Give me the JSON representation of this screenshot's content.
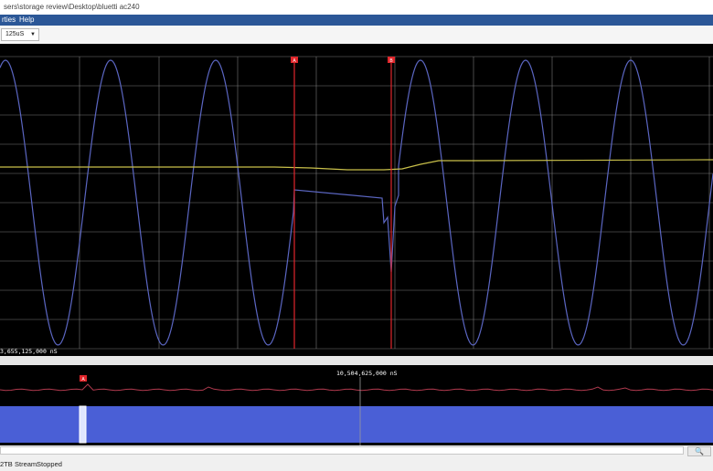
{
  "window": {
    "title": "sers\\storage review\\Desktop\\bluetti ac240"
  },
  "menu": {
    "items": [
      "rties",
      "Help"
    ]
  },
  "toolbar": {
    "timebase": "125uS"
  },
  "scope": {
    "cursor_a_label": "A",
    "cursor_b_label": "B",
    "time_readout": "3,655,125,000 nS",
    "trace_colors": {
      "voltage": "#5b66c2",
      "current": "#c9c04a",
      "grid": "#7a7a7a",
      "cursor": "#e0262b"
    }
  },
  "overview": {
    "cursor_label": "A",
    "time_readout": "10,504,625,000 nS",
    "colors": {
      "envelope": "#4a5fd6",
      "trend": "#b03a4e"
    }
  },
  "status": {
    "count": "2TB",
    "stream_label": "Stream:",
    "stream_value": "Stopped"
  },
  "icons": {
    "zoom": "magnifier-icon"
  }
}
